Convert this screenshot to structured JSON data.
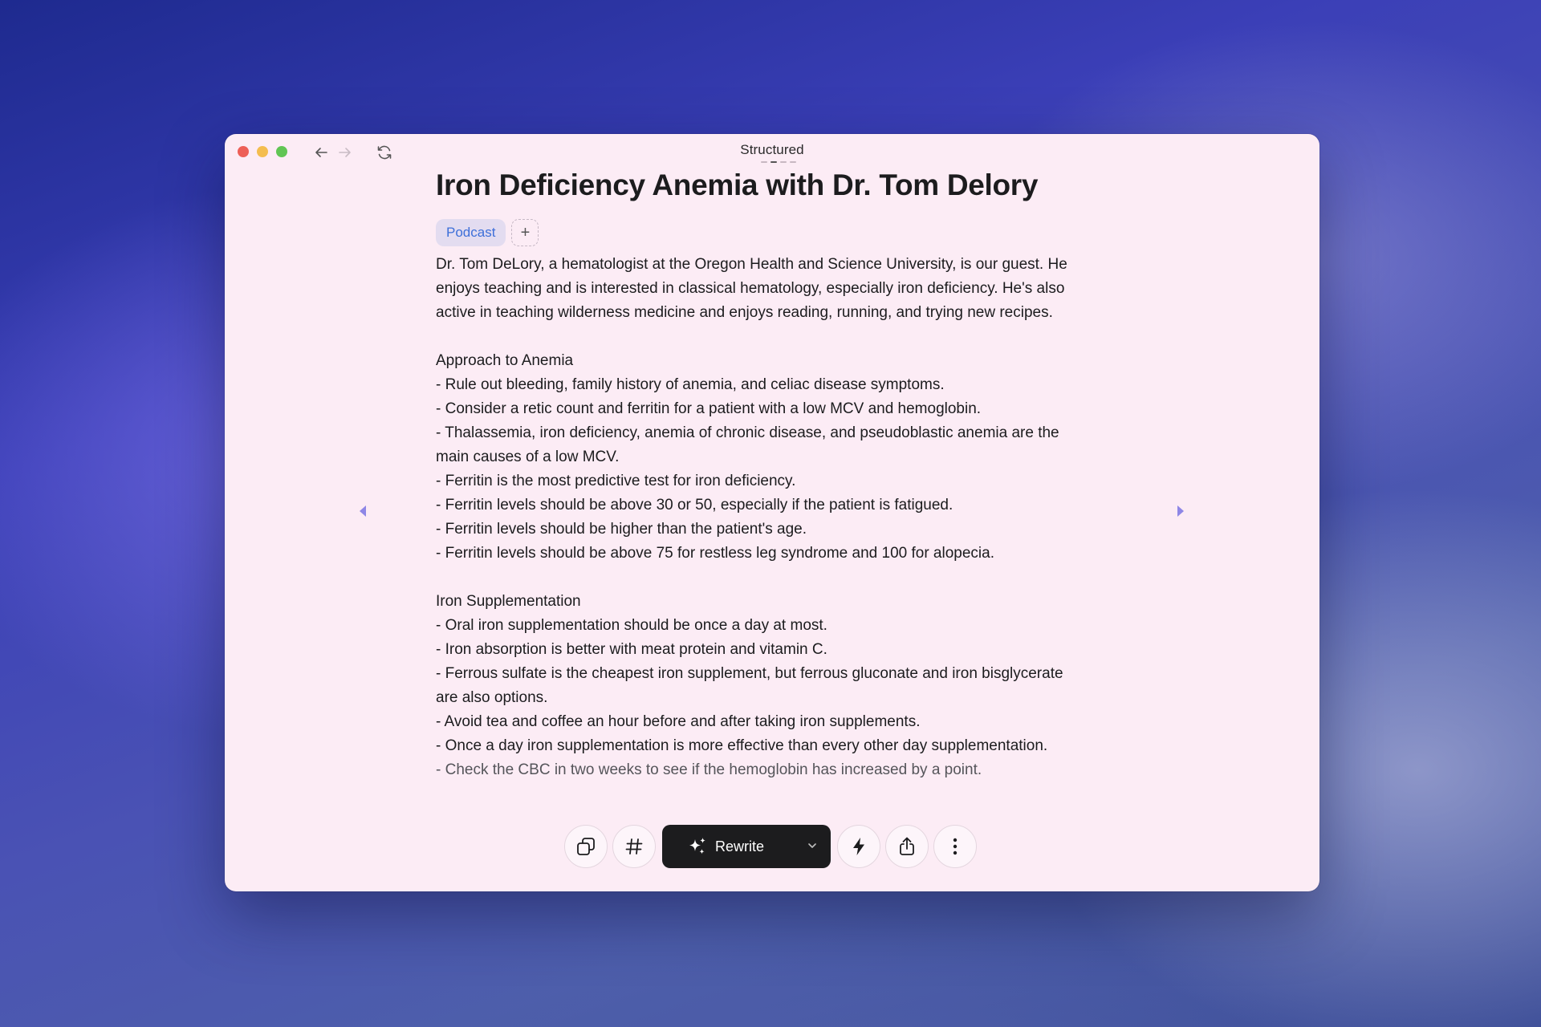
{
  "window": {
    "title": "Structured"
  },
  "document": {
    "title": "Iron Deficiency Anemia with Dr. Tom Delory",
    "tags": [
      "Podcast"
    ],
    "add_tag_label": "+",
    "intro": [
      "Dr. Tom DeLory, a hematologist at the Oregon Health and Science University, is our guest. He",
      "enjoys teaching and is interested in classical hematology, especially iron deficiency. He's also",
      "active in teaching wilderness medicine and enjoys reading, running, and trying new recipes."
    ],
    "sections": [
      {
        "heading": "Approach to Anemia",
        "lines": [
          "- Rule out bleeding, family history of anemia, and celiac disease symptoms.",
          "- Consider a retic count and ferritin for a patient with a low MCV and hemoglobin.",
          "- Thalassemia, iron deficiency, anemia of chronic disease, and pseudoblastic anemia are the",
          "main causes of a low MCV.",
          "- Ferritin is the most predictive test for iron deficiency.",
          "- Ferritin levels should be above 30 or 50, especially if the patient is fatigued.",
          "- Ferritin levels should be higher than the patient's age.",
          "- Ferritin levels should be above 75 for restless leg syndrome and 100 for alopecia."
        ]
      },
      {
        "heading": "Iron Supplementation",
        "lines": [
          "- Oral iron supplementation should be once a day at most.",
          "- Iron absorption is better with meat protein and vitamin C.",
          "- Ferrous sulfate is the cheapest iron supplement, but ferrous gluconate and iron bisglycerate",
          "are also options.",
          "- Avoid tea and coffee an hour before and after taking iron supplements.",
          "- Once a day iron supplementation is more effective than every other day supplementation.",
          "- Check the CBC in two weeks to see if the hemoglobin has increased by a point."
        ]
      }
    ]
  },
  "toolbar": {
    "rewrite_label": "Rewrite",
    "icons": [
      "duplicate-icon",
      "hashtag-icon",
      "sparkles-icon",
      "chevron-down-icon",
      "lightning-icon",
      "share-icon",
      "more-vertical-icon"
    ]
  },
  "colors": {
    "window_bg": "#fcecf5",
    "accent_blue": "#3d6fd9",
    "tag_bg": "#e3dcf0",
    "nav_arrow": "#8e86e6",
    "rewrite_bg": "#1c1c1e"
  }
}
